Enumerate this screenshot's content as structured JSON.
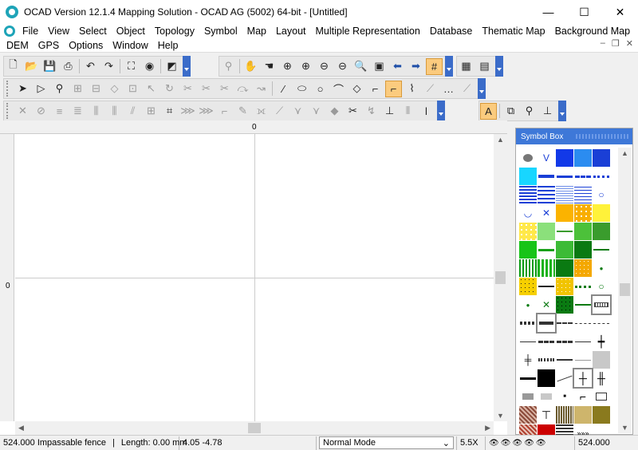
{
  "window": {
    "title": "OCAD Version 12.1.4  Mapping Solution - OCAD AG (5002) 64-bit - [Untitled]",
    "minimize": "—",
    "maximize": "☐",
    "close": "✕"
  },
  "menu": {
    "row1": [
      "File",
      "View",
      "Select",
      "Object",
      "Topology",
      "Symbol",
      "Map",
      "Layout",
      "Multiple Representation",
      "Database",
      "Thematic Map",
      "Background Map"
    ],
    "row2": [
      "DEM",
      "GPS",
      "Options",
      "Window",
      "Help"
    ],
    "mdi_minimize": "–",
    "mdi_restore": "❐",
    "mdi_close": "✕"
  },
  "toolbars": {
    "row1_icons": [
      "new-file",
      "open-folder",
      "save",
      "print",
      "undo",
      "redo",
      "fit-to-window",
      "preview",
      "draft-mode",
      "find",
      "hand-pan",
      "hand-zoom",
      "zoom-in",
      "zoom-in-alt",
      "zoom-out",
      "zoom-window",
      "zoom-previous",
      "arrow-left",
      "arrow-right",
      "grid"
    ],
    "row2_icons": [
      "edit-object",
      "edit-point",
      "select-lasso",
      "move",
      "rotate",
      "reshape",
      "curve",
      "rectangle",
      "circle",
      "freehand",
      "straight-line",
      "tool-a",
      "tool-b",
      "dotted-line",
      "line-tool"
    ],
    "row3_icons": [
      "cut",
      "merge",
      "align",
      "fill",
      "stretch",
      "spline",
      "crop",
      "reverse",
      "text",
      "dash-points",
      "corner-points",
      "convert"
    ]
  },
  "ruler": {
    "top_zero": "0",
    "left_zero": "0"
  },
  "symbol_box": {
    "title": "Symbol Box"
  },
  "status": {
    "symbol": "524.000 Impassable fence",
    "length": "Length: 0.00 mm",
    "coords": "4.05   -4.78",
    "mode": "Normal Mode",
    "zoom": "5.5X",
    "symbol_number": "524.000"
  },
  "colors": {
    "accent_blue": "#3e78d8",
    "highlight": "#fbcb7e",
    "app_teal": "#1ea4b8"
  }
}
